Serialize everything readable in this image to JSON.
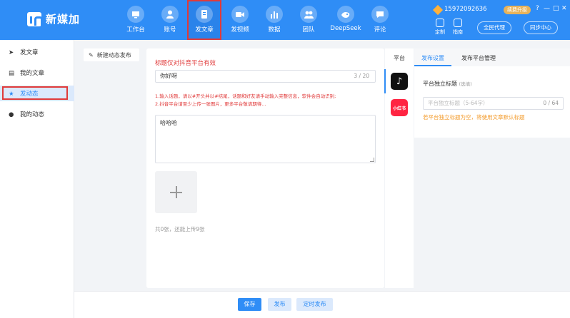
{
  "app": {
    "title": "新媒加"
  },
  "nav": [
    {
      "label": "工作台",
      "icon": "monitor-icon"
    },
    {
      "label": "账号",
      "icon": "user-icon"
    },
    {
      "label": "发文章",
      "icon": "document-icon"
    },
    {
      "label": "发视频",
      "icon": "video-icon"
    },
    {
      "label": "数据",
      "icon": "bar-chart-icon"
    },
    {
      "label": "团队",
      "icon": "team-icon"
    },
    {
      "label": "DeepSeek",
      "icon": "deepseek-whale-icon"
    },
    {
      "label": "评论",
      "icon": "comment-icon"
    }
  ],
  "header": {
    "phone": "15972092636",
    "upgrade": "续费升级",
    "custom": "定制",
    "guide": "指南",
    "proxy": "全民代理",
    "sync": "同步中心",
    "window_controls": [
      "?",
      "—",
      "□",
      "✕"
    ]
  },
  "sidebar": {
    "items": [
      "发文章",
      "我的文章",
      "发动态",
      "我的动态"
    ],
    "active": "发动态"
  },
  "new_button": "新建动态发布",
  "editor": {
    "title_hint": "标题仅对抖音平台有效",
    "title_value": "你好呀",
    "title_count": "3 / 20",
    "rule_line_1": "1.输入话题，请以#开头并以#结尾，话题和好友请手动输入完整信息，软件会自动识别;",
    "rule_line_2": "2.抖音平台请至少上传一张图片，更多平台敬请期待...",
    "content": "哈哈哈",
    "upload_hint": "共0张，还能上传9张"
  },
  "platform": {
    "title": "平台",
    "items": [
      "抖音",
      "小红书"
    ]
  },
  "settings": {
    "tabs": [
      "发布设置",
      "发布平台管理"
    ],
    "label": "平台独立标题",
    "optional": "(选填)",
    "placeholder": "平台独立标题（5-64字）",
    "count": "0 / 64",
    "warning": "若平台独立标题为空，将使用文章默认标题"
  },
  "actions": {
    "save": "保存",
    "publish": "发布",
    "schedule": "定时发布"
  },
  "colors": {
    "primary": "#2f8df6",
    "warning": "#f39b2b",
    "danger": "#e03a3a"
  }
}
